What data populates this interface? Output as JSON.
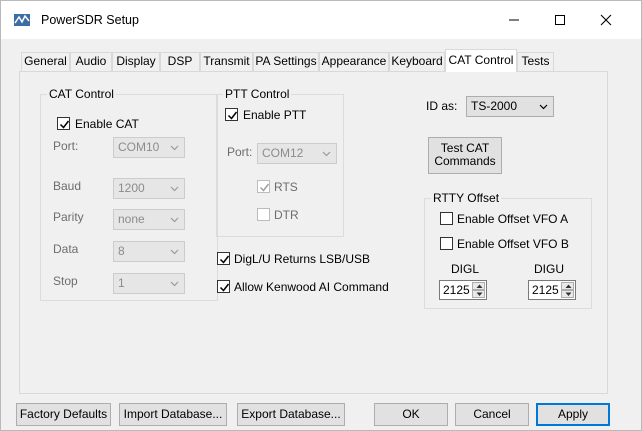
{
  "window": {
    "title": "PowerSDR Setup"
  },
  "tabs": [
    {
      "label": "General"
    },
    {
      "label": "Audio"
    },
    {
      "label": "Display"
    },
    {
      "label": "DSP"
    },
    {
      "label": "Transmit"
    },
    {
      "label": "PA Settings"
    },
    {
      "label": "Appearance"
    },
    {
      "label": "Keyboard"
    },
    {
      "label": "CAT Control",
      "active": true
    },
    {
      "label": "Tests"
    }
  ],
  "cat_control": {
    "title": "CAT Control",
    "enable_label": "Enable CAT",
    "enable_checked": true,
    "port_label": "Port:",
    "port_value": "COM10",
    "baud_label": "Baud",
    "baud_value": "1200",
    "parity_label": "Parity",
    "parity_value": "none",
    "data_label": "Data",
    "data_value": "8",
    "stop_label": "Stop",
    "stop_value": "1"
  },
  "ptt_control": {
    "title": "PTT Control",
    "enable_label": "Enable PTT",
    "enable_checked": true,
    "port_label": "Port:",
    "port_value": "COM12",
    "rts_label": "RTS",
    "rts_checked": true,
    "dtr_label": "DTR",
    "dtr_checked": false
  },
  "options": {
    "digl_label": "DigL/U Returns LSB/USB",
    "digl_checked": true,
    "kenwood_label": "Allow Kenwood AI Command",
    "kenwood_checked": true
  },
  "id_as": {
    "label": "ID as:",
    "value": "TS-2000"
  },
  "test_cat": {
    "line1": "Test CAT",
    "line2": "Commands"
  },
  "rtty_offset": {
    "title": "RTTY Offset",
    "vfoa_label": "Enable Offset VFO A",
    "vfoa_checked": false,
    "vfob_label": "Enable Offset VFO B",
    "vfob_checked": false,
    "digl_label": "DIGL",
    "digl_value": "2125",
    "digu_label": "DIGU",
    "digu_value": "2125"
  },
  "buttons": {
    "factory": "Factory Defaults",
    "import": "Import Database...",
    "export": "Export Database...",
    "ok": "OK",
    "cancel": "Cancel",
    "apply": "Apply"
  },
  "colors": {
    "accent": "#0078d7",
    "dialog_bg": "#f0f0f0",
    "panel_bg": "#ffffff"
  },
  "icons": {
    "app": "powersdr-app-icon",
    "minimize": "minimize-icon",
    "maximize": "maximize-icon",
    "close": "close-icon"
  }
}
